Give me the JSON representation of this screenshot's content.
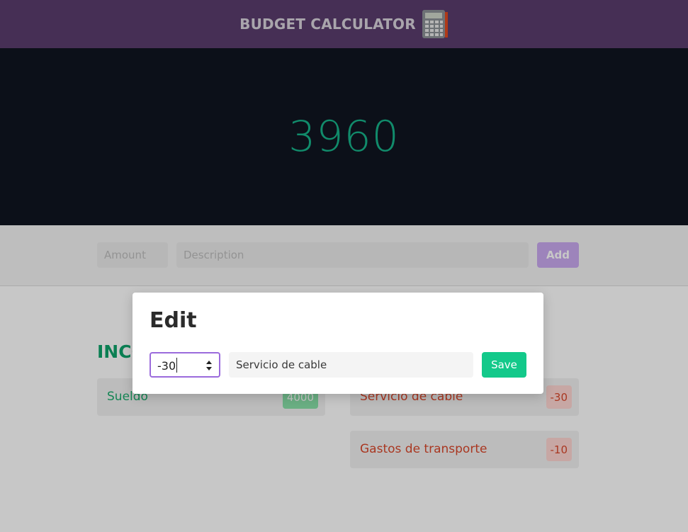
{
  "header": {
    "title": "BUDGET CALCULATOR",
    "icon": "calculator-icon"
  },
  "balance": {
    "value": "3960"
  },
  "form": {
    "amount_placeholder": "Amount",
    "description_placeholder": "Description",
    "add_label": "Add"
  },
  "income": {
    "heading": "INCO",
    "items": [
      {
        "label": "Sueldo",
        "amount": "4000"
      }
    ]
  },
  "expenses": {
    "items": [
      {
        "label": "Servicio de cable",
        "amount": "-30"
      },
      {
        "label": "Gastos de transporte",
        "amount": "-10"
      }
    ]
  },
  "modal": {
    "title": "Edit",
    "amount_value": "-30",
    "description_value": "Servicio de cable",
    "save_label": "Save"
  },
  "colors": {
    "header_bg": "#5a3d6e",
    "hero_bg": "#101520",
    "balance": "#17b38a",
    "income": "#1bab6c",
    "expense": "#d9472b",
    "save": "#13c98a",
    "add": "#c9a9f0"
  }
}
